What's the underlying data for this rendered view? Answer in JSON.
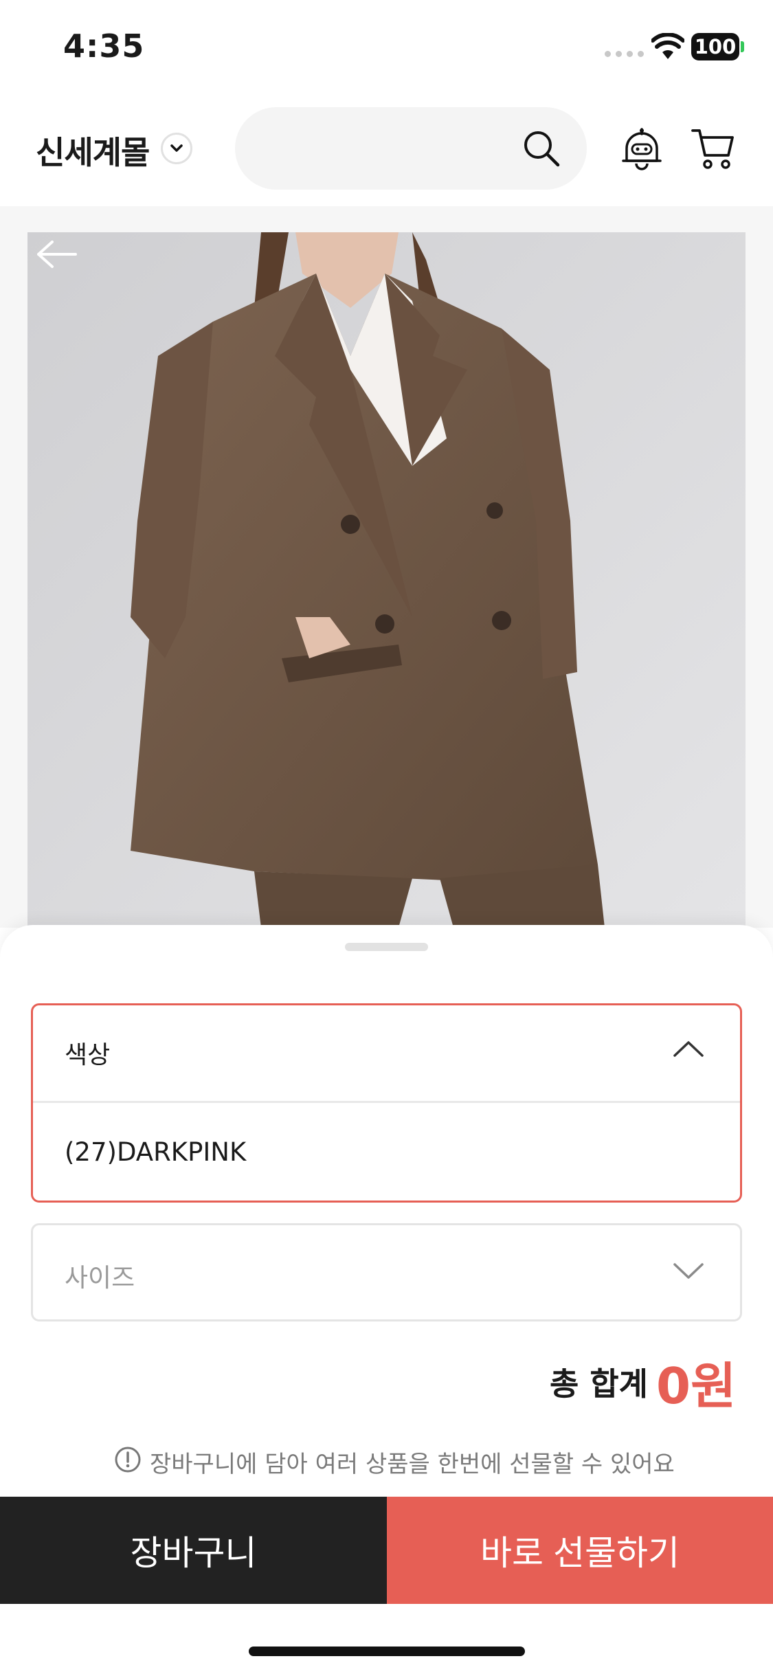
{
  "status_bar": {
    "time": "4:35",
    "battery": "100"
  },
  "header": {
    "brand": "신세계몰",
    "icons": [
      "chevron-down-icon",
      "search-icon",
      "chatbot-icon",
      "cart-icon"
    ]
  },
  "product": {
    "image_alt": "Brown double-breasted suit jacket"
  },
  "options": {
    "color": {
      "label": "색상",
      "selected": "(27)DARKPINK",
      "expanded": true
    },
    "size": {
      "placeholder": "사이즈"
    }
  },
  "total": {
    "label": "총 합계",
    "value": "0원"
  },
  "info": {
    "text": "장바구니에 담아 여러 상품을 한번에 선물할 수 있어요"
  },
  "actions": {
    "cart_label": "장바구니",
    "gift_label": "바로 선물하기"
  },
  "colors": {
    "accent": "#e65f55",
    "dark_button": "#222222"
  }
}
